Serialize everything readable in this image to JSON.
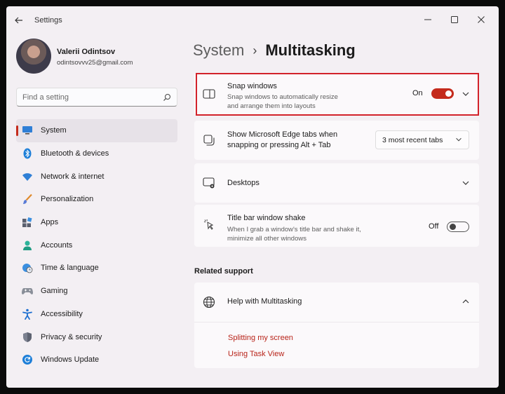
{
  "window": {
    "title": "Settings"
  },
  "user": {
    "name": "Valerii Odintsov",
    "email": "odintsovvv25@gmail.com"
  },
  "search": {
    "placeholder": "Find a setting"
  },
  "sidebar": {
    "items": [
      {
        "label": "System",
        "icon": "monitor-icon",
        "active": true
      },
      {
        "label": "Bluetooth & devices",
        "icon": "bluetooth-icon"
      },
      {
        "label": "Network & internet",
        "icon": "wifi-icon"
      },
      {
        "label": "Personalization",
        "icon": "brush-icon"
      },
      {
        "label": "Apps",
        "icon": "apps-icon"
      },
      {
        "label": "Accounts",
        "icon": "person-icon"
      },
      {
        "label": "Time & language",
        "icon": "globe-clock-icon"
      },
      {
        "label": "Gaming",
        "icon": "gamepad-icon"
      },
      {
        "label": "Accessibility",
        "icon": "accessibility-icon"
      },
      {
        "label": "Privacy & security",
        "icon": "shield-icon"
      },
      {
        "label": "Windows Update",
        "icon": "update-icon"
      }
    ]
  },
  "breadcrumb": {
    "parent": "System",
    "current": "Multitasking"
  },
  "settings": {
    "snap": {
      "title": "Snap windows",
      "desc_line1": "Snap windows to automatically resize",
      "desc_line2": "and arrange them into layouts",
      "state_label": "On",
      "enabled": true
    },
    "edge_tabs": {
      "title_line1": "Show Microsoft Edge tabs when",
      "title_line2": "snapping or pressing Alt + Tab",
      "value": "3 most recent tabs"
    },
    "desktops": {
      "title": "Desktops"
    },
    "shake": {
      "title": "Title bar window shake",
      "desc_line1": "When I grab a window's title bar and shake it,",
      "desc_line2": "minimize all other windows",
      "state_label": "Off",
      "enabled": false
    }
  },
  "related": {
    "heading": "Related support",
    "help_title": "Help with Multitasking",
    "links": [
      "Splitting my screen",
      "Using Task View"
    ]
  },
  "colors": {
    "accent": "#c42b1c",
    "highlight": "#d2222a",
    "link": "#b8241a"
  }
}
